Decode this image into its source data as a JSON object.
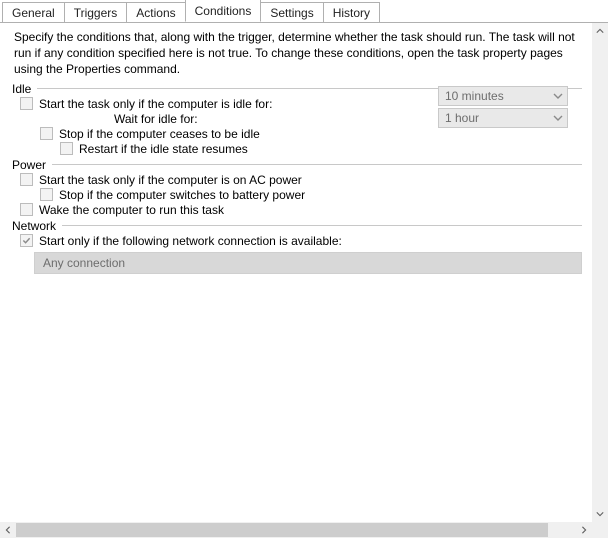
{
  "tabs": {
    "general": "General",
    "triggers": "Triggers",
    "actions": "Actions",
    "conditions": "Conditions",
    "settings": "Settings",
    "history": "History"
  },
  "intro": "Specify the conditions that, along with the trigger, determine whether the task should run.  The task will not run if any condition specified here is not true.  To change these conditions, open the task property pages using the Properties command.",
  "sections": {
    "idle": {
      "title": "Idle",
      "startIfIdle": "Start the task only if the computer is idle for:",
      "idleDuration": "10 minutes",
      "waitLabel": "Wait for idle for:",
      "waitDuration": "1 hour",
      "stopIfCeases": "Stop if the computer ceases to be idle",
      "restart": "Restart if the idle state resumes"
    },
    "power": {
      "title": "Power",
      "acPower": "Start the task only if the computer is on AC power",
      "stopBattery": "Stop if the computer switches to battery power",
      "wake": "Wake the computer to run this task"
    },
    "network": {
      "title": "Network",
      "startIfNetwork": "Start only if the following network connection is available:",
      "connection": "Any connection"
    }
  },
  "checkValues": {
    "startIfIdle": false,
    "stopIfCeases": false,
    "restart": false,
    "acPower": false,
    "stopBattery": false,
    "wake": false,
    "startIfNetwork": true
  }
}
